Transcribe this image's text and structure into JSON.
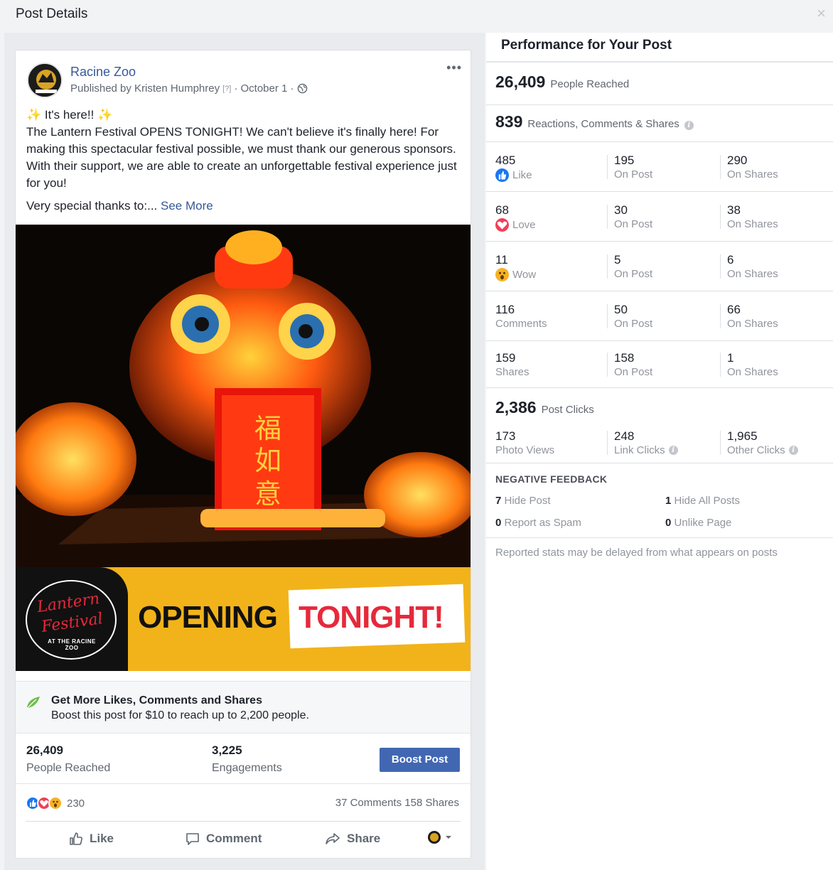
{
  "modal": {
    "title": "Post Details",
    "close_glyph": "×"
  },
  "post": {
    "page_name": "Racine Zoo",
    "published_by": "Published by Kristen Humphrey",
    "help_mark": "[?]",
    "date": "· October 1 ·",
    "more_glyph": "•••",
    "text_line1": "It's here!!",
    "sparkle": "✨",
    "text_body": "The Lantern Festival OPENS TONIGHT! We can't believe it's finally here! For making this spectacular festival possible, we must thank our generous sponsors. With their support, we are able to create an unforgettable festival experience just for you!",
    "text_thanks": "Very special thanks to:...",
    "see_more": "See More",
    "banner": {
      "logo_line1": "Lantern",
      "logo_line2": "Festival",
      "logo_sub": "AT THE RACINE ZOO",
      "opening": "OPENING",
      "tonight": "TONIGHT!"
    },
    "promo": {
      "title": "Get More Likes, Comments and Shares",
      "subtitle": "Boost this post for $10 to reach up to 2,200 people."
    },
    "stats": {
      "reached_num": "26,409",
      "reached_label": "People Reached",
      "engagements_num": "3,225",
      "engagements_label": "Engagements"
    },
    "boost_button": "Boost Post",
    "reactions_count": "230",
    "comments_shares": "37 Comments  158 Shares",
    "actions": {
      "like": "Like",
      "comment": "Comment",
      "share": "Share"
    }
  },
  "performance": {
    "title": "Performance for Your Post",
    "people_reached_num": "26,409",
    "people_reached_label": "People Reached",
    "rcs_num": "839",
    "rcs_label": "Reactions, Comments & Shares",
    "rows": [
      {
        "total": "485",
        "label": "Like",
        "icon": "like-icon",
        "on_post": "195",
        "on_shares": "290"
      },
      {
        "total": "68",
        "label": "Love",
        "icon": "love-icon",
        "on_post": "30",
        "on_shares": "38"
      },
      {
        "total": "11",
        "label": "Wow",
        "icon": "wow-icon",
        "on_post": "5",
        "on_shares": "6"
      },
      {
        "total": "116",
        "label": "Comments",
        "icon": "",
        "on_post": "50",
        "on_shares": "66"
      },
      {
        "total": "159",
        "label": "Shares",
        "icon": "",
        "on_post": "158",
        "on_shares": "1"
      }
    ],
    "on_post_label": "On Post",
    "on_shares_label": "On Shares",
    "post_clicks_num": "2,386",
    "post_clicks_label": "Post Clicks",
    "clicks": [
      {
        "num": "173",
        "label": "Photo Views"
      },
      {
        "num": "248",
        "label": "Link Clicks"
      },
      {
        "num": "1,965",
        "label": "Other Clicks"
      }
    ],
    "negative": {
      "title": "NEGATIVE FEEDBACK",
      "hide_post_num": "7",
      "hide_post_label": "Hide Post",
      "hide_all_num": "1",
      "hide_all_label": "Hide All Posts",
      "spam_num": "0",
      "spam_label": "Report as Spam",
      "unlike_num": "0",
      "unlike_label": "Unlike Page"
    },
    "footnote": "Reported stats may be delayed from what appears on posts"
  },
  "colors": {
    "link": "#385898",
    "button": "#4267b2",
    "banner": "#f2b31a",
    "red": "#e6293b"
  }
}
